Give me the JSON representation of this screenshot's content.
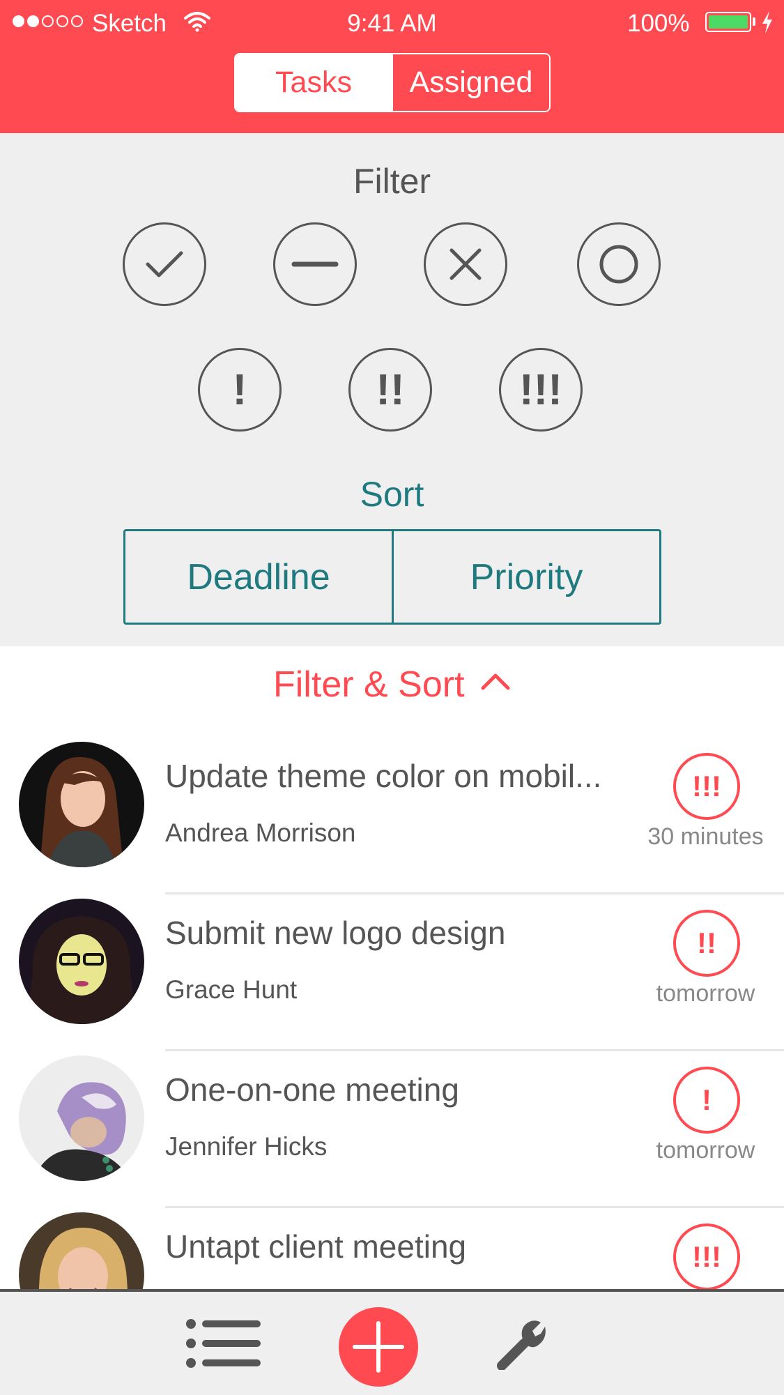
{
  "status_bar": {
    "carrier": "Sketch",
    "time": "9:41 AM",
    "battery": "100%"
  },
  "tabs": {
    "tasks": "Tasks",
    "assigned": "Assigned"
  },
  "filter": {
    "title": "Filter",
    "status_icons": [
      "check-icon",
      "minus-icon",
      "x-icon",
      "circle-icon"
    ],
    "priority_buttons": [
      "!",
      "!!",
      "!!!"
    ]
  },
  "sort": {
    "title": "Sort",
    "deadline": "Deadline",
    "priority": "Priority"
  },
  "toggle": {
    "label": "Filter & Sort"
  },
  "tasks": [
    {
      "title": "Update theme color on mobil...",
      "person": "Andrea Morrison",
      "priority": "!!!",
      "due": "30 minutes"
    },
    {
      "title": "Submit new logo design",
      "person": "Grace Hunt",
      "priority": "!!",
      "due": "tomorrow"
    },
    {
      "title": "One-on-one meeting",
      "person": "Jennifer Hicks",
      "priority": "!",
      "due": "tomorrow"
    },
    {
      "title": "Untapt client meeting",
      "person": "",
      "priority": "!!!",
      "due": ""
    }
  ],
  "tabbar": {
    "icons": [
      "list-icon",
      "plus-icon",
      "wrench-icon"
    ]
  },
  "colors": {
    "accent": "#ff4a51",
    "teal": "#1f7a80",
    "text": "#555555",
    "panel_bg": "#efefef"
  }
}
